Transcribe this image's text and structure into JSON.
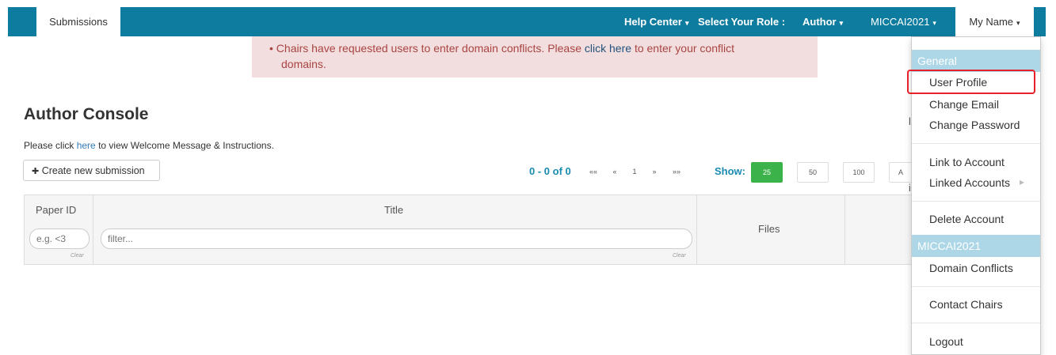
{
  "nav": {
    "tab_submissions": "Submissions",
    "help_center": "Help Center",
    "select_role_label": "Select Your Role :",
    "role": "Author",
    "conference": "MICCAI2021",
    "user": "My Name",
    "caret": "▾"
  },
  "alert": {
    "bullet": "•",
    "text_before": "Chairs have requested users to enter domain conflicts. Please",
    "link": "click here",
    "text_after": "to enter your conflict",
    "text_line2": "domains."
  },
  "page": {
    "title": "Author Console",
    "welcome_before": "Please click",
    "welcome_link": "here",
    "welcome_after": "to view Welcome Message & Instructions.",
    "create_button": "Create new submission",
    "plus_icon": "✚"
  },
  "pager": {
    "info": "0 - 0 of 0",
    "first": "««",
    "prev": "«",
    "current": "1",
    "next": "»",
    "last": "»»",
    "show_label": "Show:",
    "sizes": [
      "25",
      "50",
      "100",
      "A"
    ],
    "active_size": "25"
  },
  "table": {
    "headers": [
      "Paper ID",
      "Title",
      "Files"
    ],
    "id_filter_placeholder": "e.g. <3",
    "title_filter_placeholder": "filter...",
    "clear_label": "Clear"
  },
  "menu": {
    "section_general": "General",
    "items_general": [
      "User Profile",
      "Change Email",
      "Change Password"
    ],
    "items_account": [
      "Link to Account",
      "Linked Accounts"
    ],
    "delete": "Delete Account",
    "section_conference": "MICCAI2021",
    "domain_conflicts": "Domain Conflicts",
    "contact_chairs": "Contact Chairs",
    "logout": "Logout",
    "submenu_arrow": "▸"
  },
  "colors": {
    "navbar": "#0e7c9e",
    "alert_bg": "#f2dede",
    "alert_text": "#a94442",
    "accent": "#1a8bb0",
    "active_button": "#3cb34a",
    "menu_section": "#add7e6",
    "highlight": "#e8202a"
  }
}
